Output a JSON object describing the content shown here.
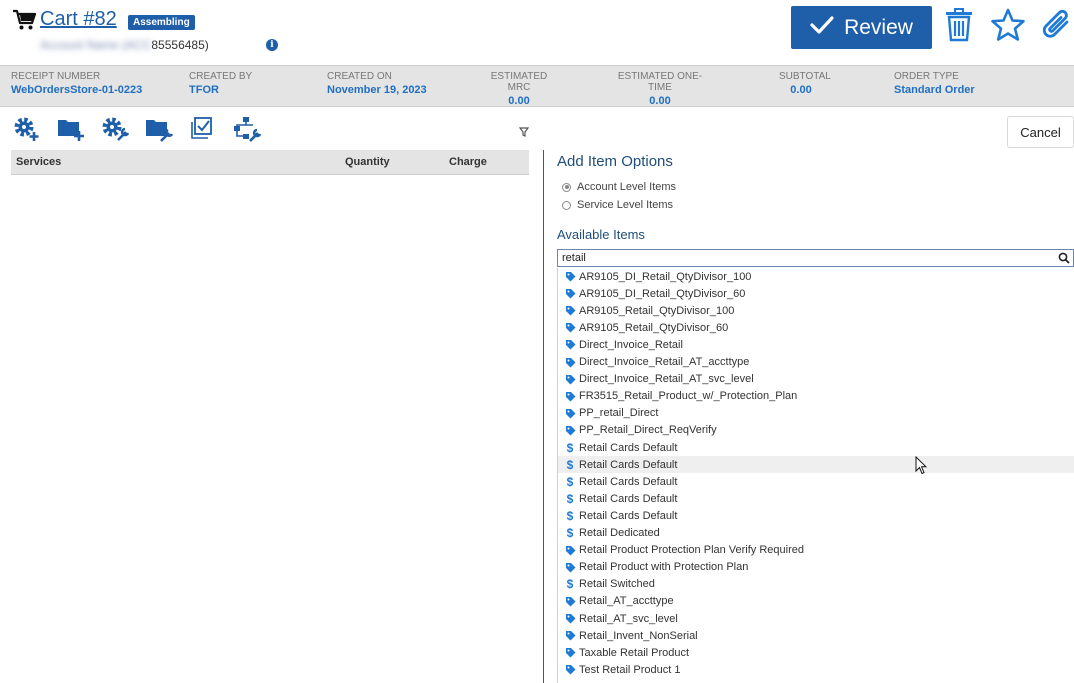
{
  "header": {
    "cart_title": "Cart #82",
    "status_badge": "Assembling",
    "account_blurred": "Account Name (ACC",
    "account_suffix": "85556485)",
    "review_label": "Review"
  },
  "summary": [
    {
      "label": "RECEIPT NUMBER",
      "value": "WebOrdersStore-01-0223"
    },
    {
      "label": "CREATED BY",
      "value": "TFOR"
    },
    {
      "label": "CREATED ON",
      "value": "November 19, 2023"
    },
    {
      "label": "ESTIMATED MRC",
      "value": "0.00"
    },
    {
      "label": "ESTIMATED ONE-TIME",
      "value": "0.00"
    },
    {
      "label": "SUBTOTAL",
      "value": "0.00"
    },
    {
      "label": "ORDER TYPE",
      "value": "Standard Order"
    }
  ],
  "toolbar": {
    "cancel_label": "Cancel",
    "icons": [
      "add-service-icon",
      "add-folder-icon",
      "configure-services-icon",
      "folder-settings-icon",
      "checklist-icon",
      "hierarchy-settings-icon"
    ]
  },
  "services_table": {
    "columns": [
      "Services",
      "Quantity",
      "Charge"
    ]
  },
  "add_item_options": {
    "title": "Add Item Options",
    "radios": [
      {
        "label": "Account Level Items",
        "selected": true
      },
      {
        "label": "Service Level Items",
        "selected": false
      }
    ],
    "available_title": "Available Items",
    "search_value": "retail"
  },
  "available_items": [
    {
      "icon": "tag-icon",
      "label": "AR9105_DI_Retail_QtyDivisor_100"
    },
    {
      "icon": "tag-icon",
      "label": "AR9105_DI_Retail_QtyDivisor_60"
    },
    {
      "icon": "tag-icon",
      "label": "AR9105_Retail_QtyDivisor_100"
    },
    {
      "icon": "tag-icon",
      "label": "AR9105_Retail_QtyDivisor_60"
    },
    {
      "icon": "tag-icon",
      "label": "Direct_Invoice_Retail"
    },
    {
      "icon": "tag-icon",
      "label": "Direct_Invoice_Retail_AT_accttype"
    },
    {
      "icon": "tag-icon",
      "label": "Direct_Invoice_Retail_AT_svc_level"
    },
    {
      "icon": "tag-icon",
      "label": "FR3515_Retail_Product_w/_Protection_Plan"
    },
    {
      "icon": "tag-icon",
      "label": "PP_retail_Direct"
    },
    {
      "icon": "tag-icon",
      "label": "PP_Retail_Direct_ReqVerify"
    },
    {
      "icon": "dollar-icon",
      "label": "Retail Cards Default"
    },
    {
      "icon": "dollar-icon",
      "label": "Retail Cards Default",
      "highlighted": true
    },
    {
      "icon": "dollar-icon",
      "label": "Retail Cards Default"
    },
    {
      "icon": "dollar-icon",
      "label": "Retail Cards Default"
    },
    {
      "icon": "dollar-icon",
      "label": "Retail Cards Default"
    },
    {
      "icon": "dollar-icon",
      "label": "Retail Dedicated"
    },
    {
      "icon": "tag-icon",
      "label": "Retail Product Protection Plan Verify Required"
    },
    {
      "icon": "tag-icon",
      "label": "Retail Product with Protection Plan"
    },
    {
      "icon": "dollar-icon",
      "label": "Retail Switched"
    },
    {
      "icon": "tag-icon",
      "label": "Retail_AT_accttype"
    },
    {
      "icon": "tag-icon",
      "label": "Retail_AT_svc_level"
    },
    {
      "icon": "tag-icon",
      "label": "Retail_Invent_NonSerial"
    },
    {
      "icon": "tag-icon",
      "label": "Taxable Retail Product"
    },
    {
      "icon": "tag-icon",
      "label": "Test Retail Product 1"
    }
  ],
  "colors": {
    "accent": "#1f5ea8",
    "link": "#1f6fc4",
    "icon_blue": "#1f7ad6",
    "header_band": "#e4e4e4"
  }
}
